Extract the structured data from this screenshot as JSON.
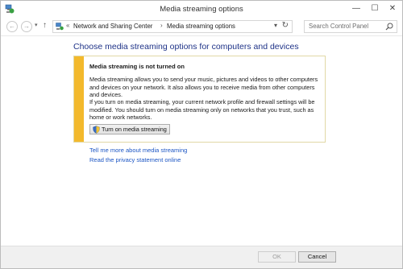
{
  "window": {
    "title": "Media streaming options",
    "minimize_glyph": "—",
    "maximize_glyph": "☐",
    "close_glyph": "✕"
  },
  "nav": {
    "back_glyph": "←",
    "forward_glyph": "→",
    "recent_glyph": "▾",
    "up_glyph": "↑",
    "breadcrumb_sep": "«",
    "breadcrumbs": [
      "Network and Sharing Center",
      "Media streaming options"
    ],
    "crumb_arrow": "›",
    "dropdown_glyph": "▾",
    "refresh_glyph": "↻"
  },
  "search": {
    "placeholder": "Search Control Panel"
  },
  "main": {
    "heading": "Choose media streaming options for computers and devices",
    "notice": {
      "title": "Media streaming is not turned on",
      "paragraph1": "Media streaming allows you to send your music, pictures and videos to other computers and devices on your network.  It also allows you to receive media from other computers and devices.",
      "paragraph2": "If you turn on media streaming, your current network profile and firewall settings will be modified. You should turn on media streaming only on networks that you trust, such as home or work networks.",
      "button_label": "Turn on media streaming"
    },
    "links": [
      "Tell me more about media streaming",
      "Read the privacy statement online"
    ]
  },
  "footer": {
    "ok_label": "OK",
    "cancel_label": "Cancel"
  },
  "colors": {
    "heading": "#1e3287",
    "link": "#1c56c4",
    "notice_stripe": "#f3b92c"
  }
}
